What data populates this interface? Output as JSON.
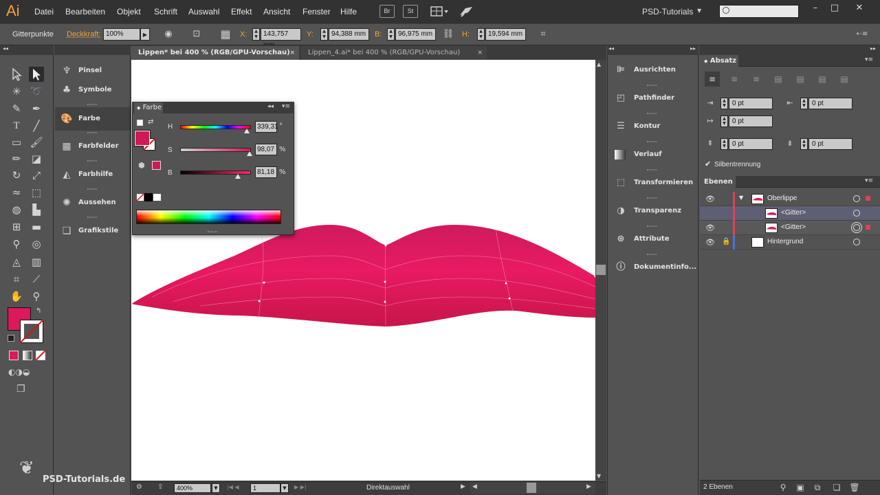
{
  "app": {
    "logo": "Ai",
    "menu": [
      "Datei",
      "Bearbeiten",
      "Objekt",
      "Schrift",
      "Auswahl",
      "Effekt",
      "Ansicht",
      "Fenster",
      "Hilfe"
    ],
    "bridge_label": "Br",
    "stock_label": "St",
    "workspace": "PSD-Tutorials",
    "search_placeholder": ""
  },
  "control_bar": {
    "selection_label": "Gitterpunkte",
    "opacity_label": "Deckkraft:",
    "opacity_value": "100%",
    "x_label": "X:",
    "x_value": "143,757 mm",
    "y_label": "Y:",
    "y_value": "94,388 mm",
    "b_label": "B:",
    "b_value": "96,975 mm",
    "h_label": "H:",
    "h_value": "19,594 mm"
  },
  "left_dock": {
    "items": [
      {
        "label": "Pinsel",
        "icon": "brush-icon"
      },
      {
        "label": "Symbole",
        "icon": "symbols-icon"
      },
      {
        "label": "Farbe",
        "icon": "color-palette-icon"
      },
      {
        "label": "Farbfelder",
        "icon": "swatches-icon"
      },
      {
        "label": "Farbhilfe",
        "icon": "color-guide-icon"
      },
      {
        "label": "Aussehen",
        "icon": "appearance-icon"
      },
      {
        "label": "Grafikstile",
        "icon": "graphic-styles-icon"
      }
    ]
  },
  "tabs": [
    {
      "label": "Lippen* bei 400 % (RGB/GPU-Vorschau)",
      "close": "×"
    },
    {
      "label": "Lippen_4.ai* bei 400 % (RGB/GPU-Vorschau)",
      "close": "×"
    }
  ],
  "color_panel": {
    "title": "Farbe",
    "h_label": "H",
    "h_value": "339,31",
    "h_unit": "°",
    "h_fraction": 0.9425,
    "s_label": "S",
    "s_value": "98,07",
    "s_unit": "%",
    "s_fraction": 0.9807,
    "b_label": "B",
    "b_value": "81,18",
    "b_unit": "%",
    "b_fraction": 0.8118,
    "fill_color": "#cf1b55"
  },
  "status_bar": {
    "zoom": "400%",
    "artboard": "1",
    "tool": "Direktauswahl"
  },
  "right_dock": {
    "items": [
      {
        "label": "Ausrichten",
        "icon": "align-icon"
      },
      {
        "label": "Pathfinder",
        "icon": "pathfinder-icon"
      },
      {
        "label": "Kontur",
        "icon": "stroke-icon"
      },
      {
        "label": "Verlauf",
        "icon": "gradient-icon"
      },
      {
        "label": "Transformieren",
        "icon": "transform-icon"
      },
      {
        "label": "Transparenz",
        "icon": "transparency-icon"
      },
      {
        "label": "Attribute",
        "icon": "attributes-icon"
      },
      {
        "label": "Dokumentinfo...",
        "icon": "document-info-icon"
      }
    ]
  },
  "paragraph_panel": {
    "title": "Absatz",
    "left_indent": "0 pt",
    "right_indent": "0 pt",
    "first_line_indent": "0 pt",
    "space_before": "0 pt",
    "space_after": "0 pt",
    "hyphenation_label": "Silbentrennung",
    "hyphenation_checked": true
  },
  "layers_panel": {
    "title": "Ebenen",
    "rows": [
      {
        "name": "Oberlippe",
        "color": "#e0405a",
        "type": "layer"
      },
      {
        "name": "<Gitter>",
        "color": "#e0405a",
        "type": "item"
      },
      {
        "name": "<Gitter>",
        "color": "#e0405a",
        "type": "item"
      },
      {
        "name": "Hintergrund",
        "color": "#4f6fe0",
        "type": "layer"
      }
    ],
    "count": "2 Ebenen"
  },
  "watermark": "PSD-Tutorials.de",
  "colors": {
    "lip_fill": "#d8185a",
    "accent_orange": "#f2a33a"
  }
}
